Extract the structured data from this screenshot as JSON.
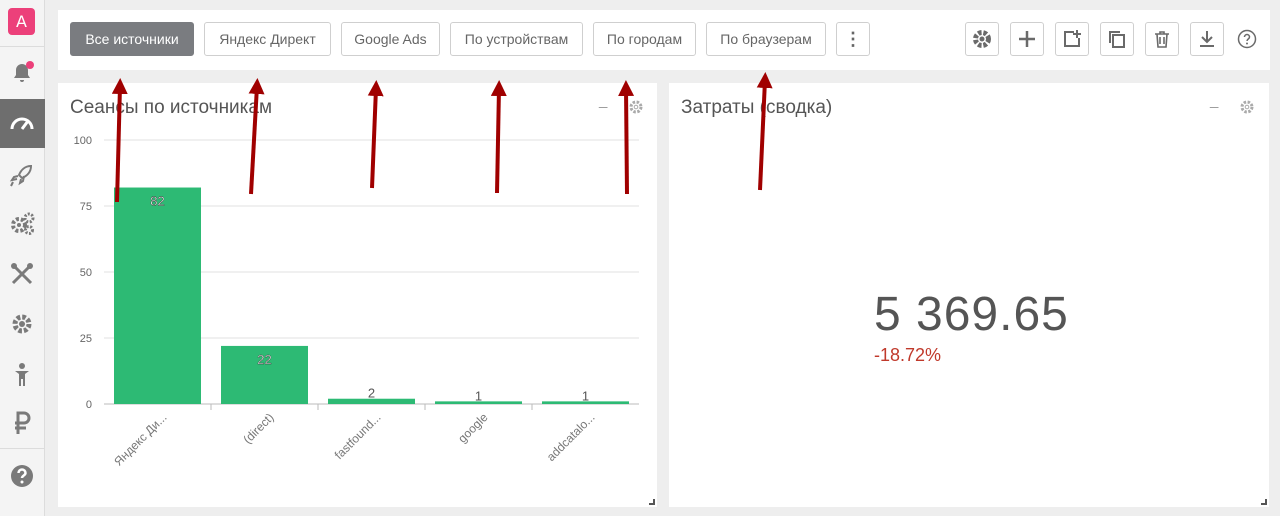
{
  "app": {
    "logo_letter": "A"
  },
  "sidebar": {
    "items": [
      {
        "icon": "bell-icon",
        "has_badge": true
      },
      {
        "icon": "dashboard-icon",
        "active": true
      },
      {
        "icon": "rocket-icon"
      },
      {
        "icon": "gears-icon"
      },
      {
        "icon": "tools-icon"
      },
      {
        "icon": "gear-icon"
      },
      {
        "icon": "person-icon"
      },
      {
        "icon": "ruble-icon"
      },
      {
        "icon": "help-icon"
      }
    ]
  },
  "toolbar": {
    "tabs": [
      {
        "label": "Все источники",
        "active": true
      },
      {
        "label": "Яндекс Директ"
      },
      {
        "label": "Google Ads"
      },
      {
        "label": "По устройствам"
      },
      {
        "label": "По городам"
      },
      {
        "label": "По браузерам"
      }
    ],
    "more_label": "⋮",
    "help_label": "?",
    "tools": [
      "settings-icon",
      "add-icon",
      "add-widget-icon",
      "copy-icon",
      "delete-icon",
      "download-icon"
    ]
  },
  "panels": {
    "sessions": {
      "title": "Сеансы по источникам",
      "min_label": "_"
    },
    "costs": {
      "title": "Затраты (сводка)",
      "min_label": "_",
      "value": "5 369.65",
      "delta": "-18.72%"
    }
  },
  "colors": {
    "bar": "#2dba74",
    "accent": "#ec407a",
    "negative": "#c0392b",
    "arrow": "#a00000",
    "active_tab": "#7a7c80"
  },
  "chart_data": {
    "type": "bar",
    "categories": [
      "Яндекс Ди...",
      "(direct)",
      "fastfound...",
      "google",
      "addcatalo..."
    ],
    "values": [
      82,
      22,
      2,
      1,
      1
    ],
    "y_ticks": [
      "100",
      "75",
      "50",
      "25",
      "0"
    ],
    "ylim": [
      0,
      100
    ],
    "grid": true
  }
}
